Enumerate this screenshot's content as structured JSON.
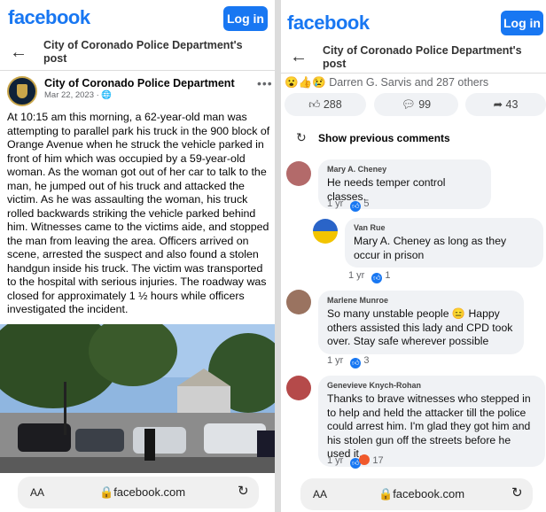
{
  "left": {
    "brand": "facebook",
    "login_label": "Log in",
    "nav_title_line1": "City of Coronado Police Department's",
    "nav_title_line2": "post",
    "author": "City of Coronado Police Department",
    "date": "Mar 22, 2023 · ",
    "post_text": "At 10:15 am this morning, a 62-year-old man was attempting to parallel park his truck in the 900 block of Orange Avenue when he struck the vehicle parked in front of him which was occupied by a 59-year-old woman. As the woman got out of her car to talk to the man, he jumped out of his truck and attacked the victim. As he was assaulting the woman, his truck rolled backwards striking the vehicle parked behind him. Witnesses came to the victims aide, and stopped the man from leaving the area. Officers arrived on scene, arrested the suspect and also found a stolen handgun inside his truck. The victim was transported to the hospital with serious injuries. The roadway was closed for approximately 1 ½ hours while officers investigated the incident.",
    "url_aa": "AA",
    "url": "facebook.com"
  },
  "right": {
    "brand": "facebook",
    "login_label": "Log in",
    "nav_title_line1": "City of Coronado Police Department's",
    "nav_title_line2": "post",
    "reactions_text": "Darren G. Sarvis and 287 others",
    "likes": "288",
    "comments_count": "99",
    "shares": "43",
    "show_previous": "Show previous comments",
    "comments": [
      {
        "name": "Mary A. Cheney",
        "text": "He needs temper control classes.",
        "age": "1 yr",
        "count": "5"
      },
      {
        "name": "Van Rue",
        "text": "Mary A. Cheney as long as they occur in prison",
        "age": "1 yr",
        "count": "1"
      },
      {
        "name": "Marlene Munroe",
        "text": "So many unstable people 😑 Happy others assisted this lady and CPD took over. Stay safe wherever possible",
        "age": "1 yr",
        "count": "3"
      },
      {
        "name": "Genevieve Knych-Rohan",
        "text": "Thanks to brave witnesses who stepped in to help and held the attacker till the police could arrest him. I'm glad they got him and his stolen gun off the streets before he used it.",
        "age": "1 yr",
        "count": "17"
      }
    ],
    "url_aa": "AA",
    "url": "facebook.com"
  },
  "colors": {
    "brand": "#1877f2",
    "bubble": "#f0f2f5",
    "muted": "#65676b"
  }
}
